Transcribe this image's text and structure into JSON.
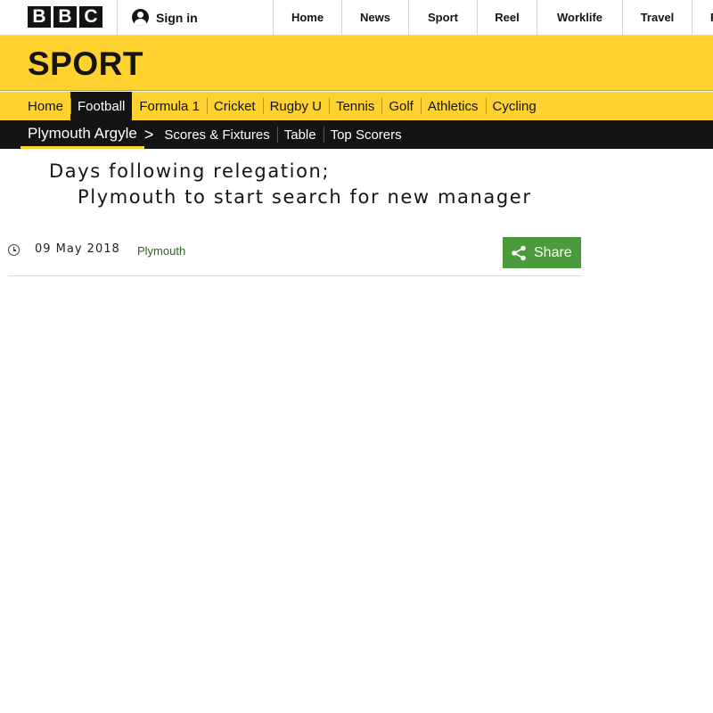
{
  "header": {
    "logo_letters": [
      "B",
      "B",
      "C"
    ],
    "signin_label": "Sign in",
    "nav": [
      "Home",
      "News",
      "Sport",
      "Reel",
      "Worklife",
      "Travel",
      "F"
    ]
  },
  "sport": {
    "title": "SPORT",
    "tabs": [
      "Home",
      "Football",
      "Formula 1",
      "Cricket",
      "Rugby U",
      "Tennis",
      "Golf",
      "Athletics",
      "Cycling"
    ],
    "active_tab": "Football"
  },
  "subnav": {
    "team": "Plymouth Argyle",
    "links": [
      "Scores & Fixtures",
      "Table",
      "Top Scorers"
    ]
  },
  "article": {
    "headline_line1": "Days following relegation;",
    "headline_line2": "Plymouth to start search for new manager",
    "date": "09 May 2018",
    "tag": "Plymouth",
    "share_label": "Share"
  },
  "colors": {
    "sport_yellow": "#ffd230",
    "share_green": "#4b9a3b",
    "nav_black": "#141414"
  }
}
